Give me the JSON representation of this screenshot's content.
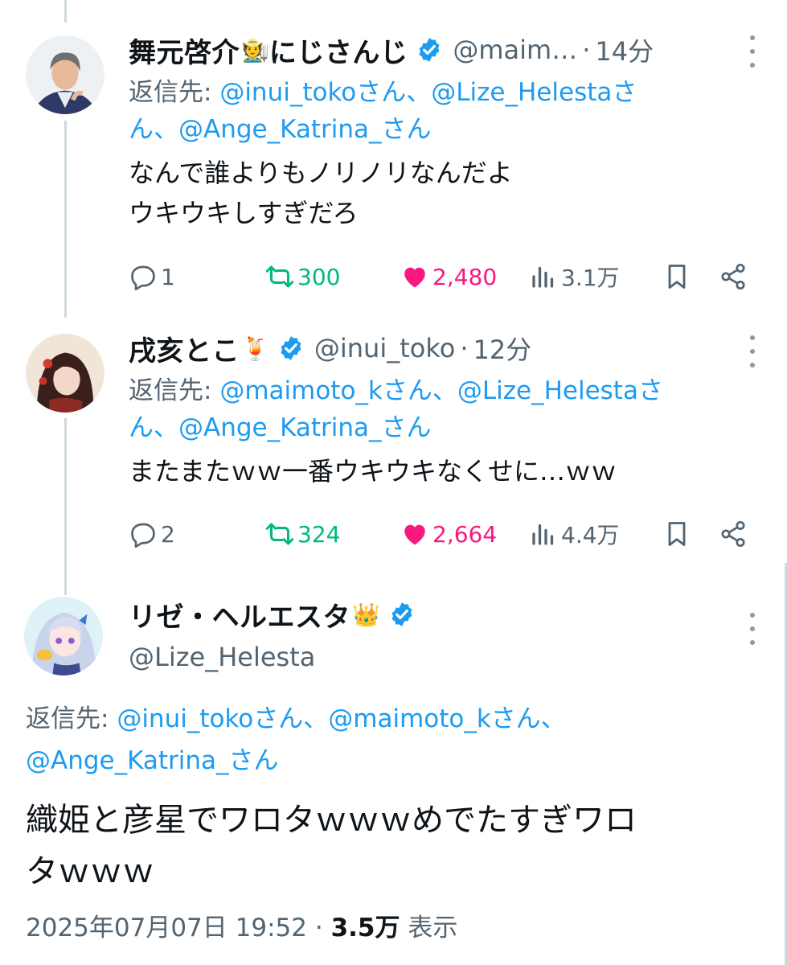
{
  "tweets": [
    {
      "name": "舞元啓介",
      "emoji": "🧑‍🌾",
      "name_suffix": "にじさんじ",
      "handle": "@maim…",
      "time": "14分",
      "reply_prefix": "返信先:",
      "reply_line1_mentions": "@inui_tokoさん、@Lize_Helestaさ",
      "reply_line2_mentions": "ん、@Ange_Katrina_さん",
      "text_line1": "なんで誰よりもノリノリなんだよ",
      "text_line2": "ウキウキしすぎだろ",
      "replies": "1",
      "retweets": "300",
      "likes": "2,480",
      "views": "3.1万"
    },
    {
      "name": "戌亥とこ",
      "emoji": "🍹",
      "handle": "@inui_toko",
      "time": "12分",
      "reply_prefix": "返信先:",
      "reply_line1_mentions": "@maimoto_kさん、@Lize_Helestaさ",
      "reply_line2_mentions": "ん、@Ange_Katrina_さん",
      "text_line1": "またまたｗｗ一番ウキウキなくせに…ｗｗ",
      "replies": "2",
      "retweets": "324",
      "likes": "2,664",
      "views": "4.4万"
    }
  ],
  "main": {
    "name": "リゼ・ヘルエスタ",
    "emoji": "👑",
    "handle": "@Lize_Helesta",
    "reply_prefix": "返信先:",
    "reply_line1_mentions": "@inui_tokoさん、@maimoto_kさん、",
    "reply_line2_mentions": "@Ange_Katrina_さん",
    "text_line1": "織姫と彦星でワロタｗｗｗめでたすぎワロ",
    "text_line2": "タｗｗｗ",
    "date": "2025年07月07日 19:52",
    "views_count": "3.5万",
    "views_label": "表示"
  },
  "colors": {
    "link": "#1d9bf0",
    "secondary": "#536471",
    "retweet": "#00ba7c",
    "like": "#f91880",
    "verified": "#1d9bf0"
  },
  "icons": [
    "reply-icon",
    "retweet-icon",
    "like-icon",
    "views-icon",
    "bookmark-icon",
    "share-icon",
    "verified-badge-icon",
    "more-icon"
  ]
}
